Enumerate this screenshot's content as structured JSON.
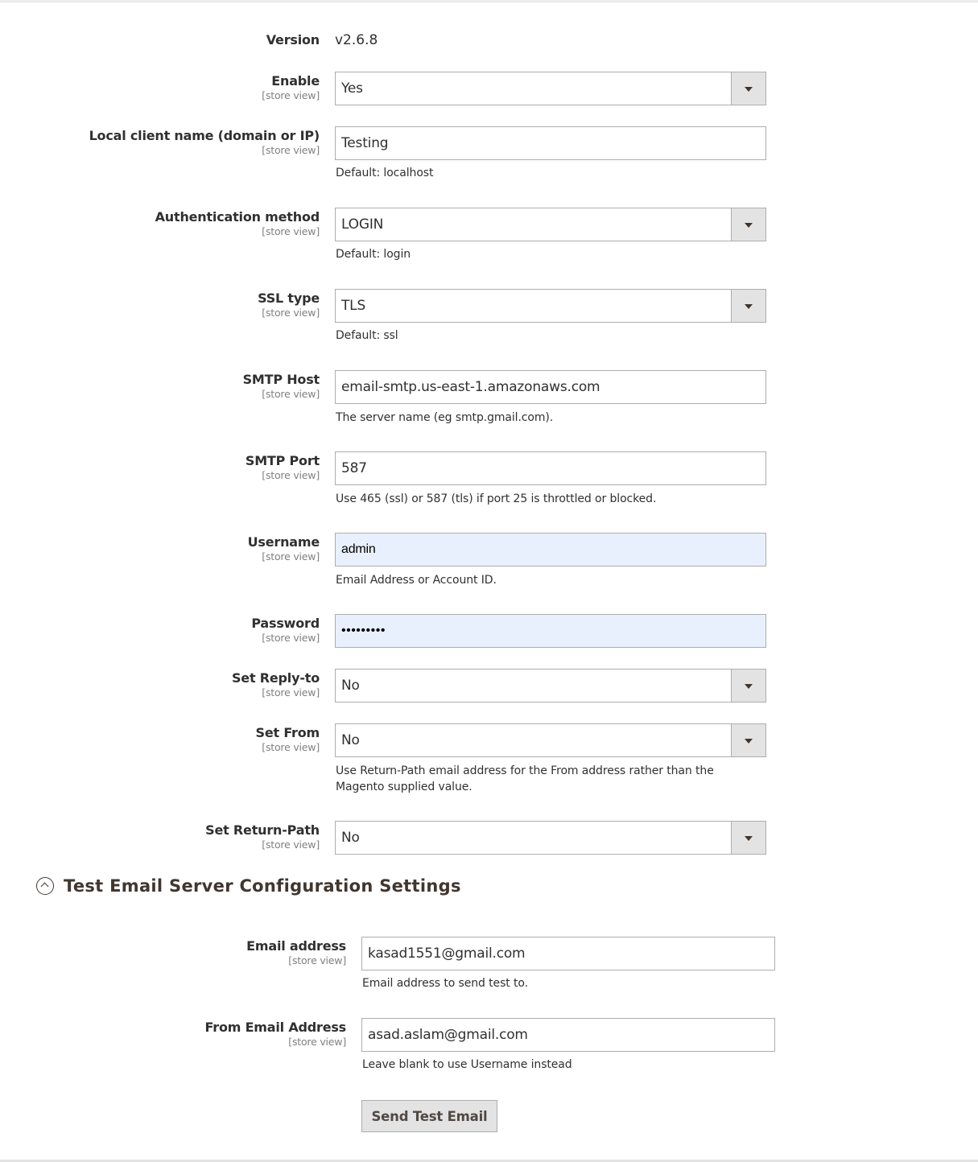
{
  "smtp": {
    "version": {
      "label": "Version",
      "value": "v2.6.8"
    },
    "scope_label": "[store view]",
    "fields": {
      "enable": {
        "label": "Enable",
        "value": "Yes"
      },
      "client_name": {
        "label": "Local client name (domain or IP)",
        "value": "Testing",
        "hint": "Default: localhost"
      },
      "auth_method": {
        "label": "Authentication method",
        "value": "LOGIN",
        "hint": "Default: login"
      },
      "ssl_type": {
        "label": "SSL type",
        "value": "TLS",
        "hint": "Default: ssl"
      },
      "smtp_host": {
        "label": "SMTP Host",
        "value": "email-smtp.us-east-1.amazonaws.com",
        "hint": "The server name (eg smtp.gmail.com)."
      },
      "smtp_port": {
        "label": "SMTP Port",
        "value": "587",
        "hint": "Use 465 (ssl) or 587 (tls) if port 25 is throttled or blocked."
      },
      "username": {
        "label": "Username",
        "value": "admin",
        "hint": "Email Address or Account ID."
      },
      "password": {
        "label": "Password",
        "value": "•••••••••"
      },
      "set_reply_to": {
        "label": "Set Reply-to",
        "value": "No"
      },
      "set_from": {
        "label": "Set From",
        "value": "No",
        "hint": "Use Return-Path email address for the From address rather than the Magento supplied value."
      },
      "set_return_path": {
        "label": "Set Return-Path",
        "value": "No"
      }
    }
  },
  "test_section": {
    "title": "Test Email Server Configuration Settings",
    "toggle_icon": "chevron-up-circle-icon",
    "fields": {
      "email_address": {
        "label": "Email address",
        "value": "kasad1551@gmail.com",
        "hint": "Email address to send test to."
      },
      "from_email": {
        "label": "From Email Address",
        "value": "asad.aslam@gmail.com",
        "hint": "Leave blank to use Username instead"
      }
    },
    "send_button": "Send Test Email"
  },
  "colors": {
    "text": "#303030",
    "scope_text": "#808080",
    "border": "#adadad",
    "select_button_bg": "#e3e3e3",
    "autofill_bg": "#e8f0fe",
    "heading": "#41362f"
  }
}
